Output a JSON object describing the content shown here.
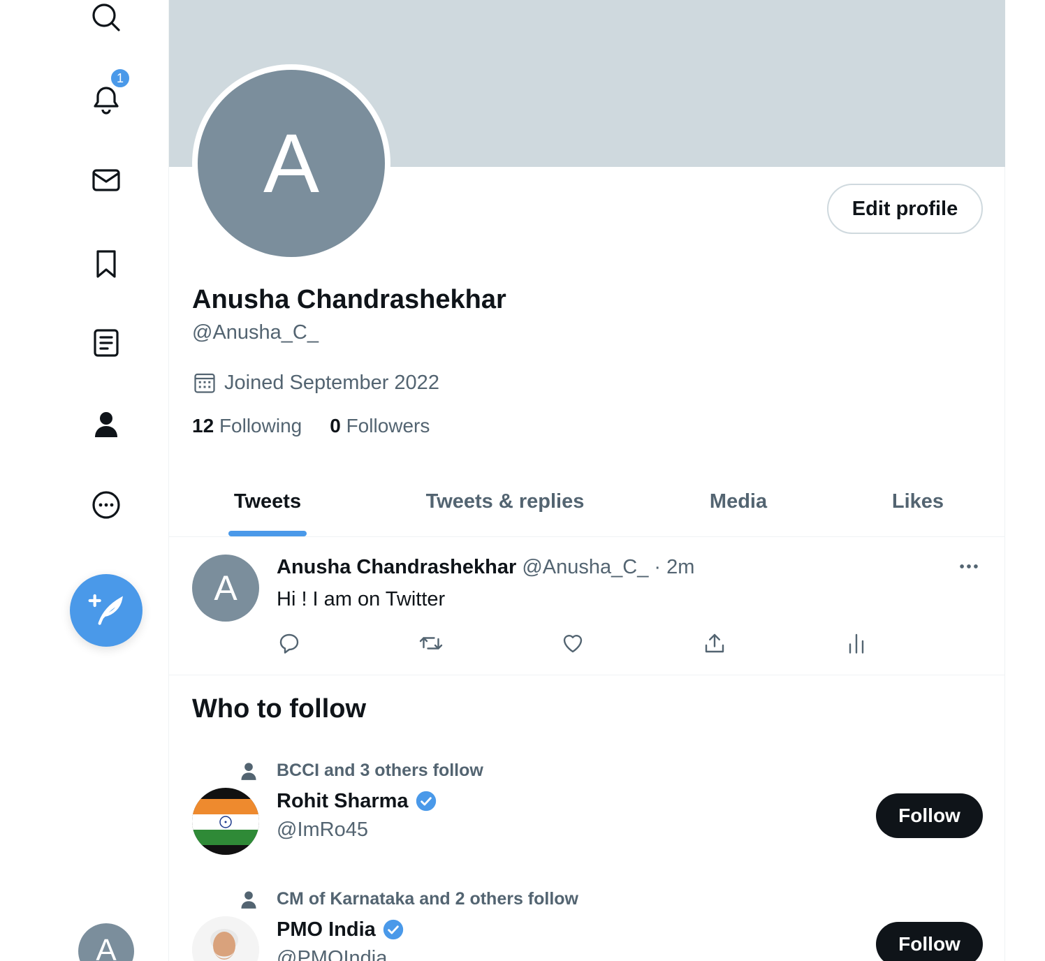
{
  "nav": {
    "notifications_badge": "1",
    "items": [
      "search-icon",
      "bell-icon",
      "mail-icon",
      "bookmark-icon",
      "list-icon",
      "profile-icon",
      "more-circle-icon"
    ]
  },
  "account": {
    "avatar_letter": "A"
  },
  "profile": {
    "avatar_letter": "A",
    "edit_label": "Edit profile",
    "display_name": "Anusha Chandrashekhar",
    "handle": "@Anusha_C_",
    "joined": "Joined September 2022",
    "following_count": "12",
    "following_label": "Following",
    "followers_count": "0",
    "followers_label": "Followers"
  },
  "tabs": [
    {
      "label": "Tweets",
      "active": true
    },
    {
      "label": "Tweets & replies",
      "active": false
    },
    {
      "label": "Media",
      "active": false
    },
    {
      "label": "Likes",
      "active": false
    }
  ],
  "tweet": {
    "avatar_letter": "A",
    "name": "Anusha Chandrashekhar",
    "handle": "@Anusha_C_",
    "separator": "·",
    "time": "2m",
    "text": "Hi ! I am on Twitter"
  },
  "who_to_follow": {
    "title": "Who to follow",
    "suggestions": [
      {
        "social": "BCCI and 3 others follow",
        "name": "Rohit Sharma",
        "handle": "@ImRo45",
        "verified": true,
        "follow_label": "Follow"
      },
      {
        "social": "CM of Karnataka and 2 others follow",
        "name": "PMO India",
        "handle": "@PMOIndia",
        "verified": true,
        "follow_label": "Follow"
      }
    ]
  },
  "colors": {
    "accent": "#4a99e9",
    "banner": "#cfd9de",
    "avatar": "#7b8e9c",
    "text_primary": "#0f1419",
    "text_secondary": "#536471"
  }
}
